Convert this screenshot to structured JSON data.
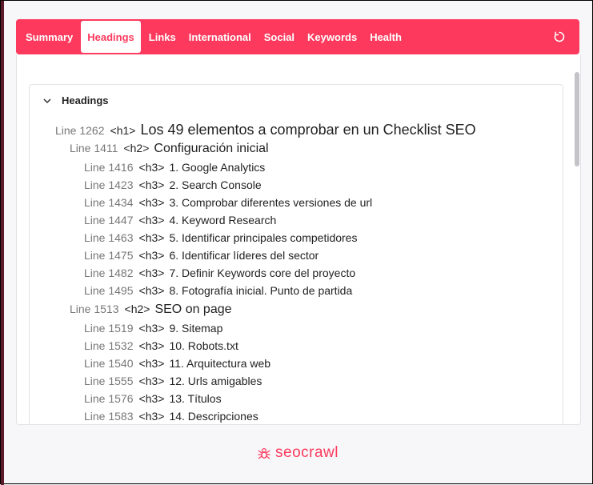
{
  "nav": {
    "tabs": [
      {
        "label": "Summary",
        "active": false
      },
      {
        "label": "Headings",
        "active": true
      },
      {
        "label": "Links",
        "active": false
      },
      {
        "label": "International",
        "active": false
      },
      {
        "label": "Social",
        "active": false
      },
      {
        "label": "Keywords",
        "active": false
      },
      {
        "label": "Health",
        "active": false
      }
    ],
    "refresh_icon": "refresh-icon"
  },
  "colors": {
    "brand": "#fd3a5d",
    "text": "#222222",
    "muted": "#777777"
  },
  "headings": {
    "title": "Headings",
    "toggle_icon": "chevron-down-icon",
    "items": [
      {
        "line": "Line 1262",
        "tag": "<h1>",
        "text": "Los 49 elementos a comprobar en un Checklist SEO",
        "level": 1
      },
      {
        "line": "Line 1411",
        "tag": "<h2>",
        "text": "Configuración inicial",
        "level": 2
      },
      {
        "line": "Line 1416",
        "tag": "<h3>",
        "text": "1. Google Analytics",
        "level": 3
      },
      {
        "line": "Line 1423",
        "tag": "<h3>",
        "text": "2. Search Console",
        "level": 3
      },
      {
        "line": "Line 1434",
        "tag": "<h3>",
        "text": "3. Comprobar diferentes versiones de url",
        "level": 3
      },
      {
        "line": "Line 1447",
        "tag": "<h3>",
        "text": "4. Keyword Research",
        "level": 3
      },
      {
        "line": "Line 1463",
        "tag": "<h3>",
        "text": "5. Identificar principales competidores",
        "level": 3
      },
      {
        "line": "Line 1475",
        "tag": "<h3>",
        "text": "6. Identificar líderes del sector",
        "level": 3
      },
      {
        "line": "Line 1482",
        "tag": "<h3>",
        "text": "7. Definir Keywords core del proyecto",
        "level": 3
      },
      {
        "line": "Line 1495",
        "tag": "<h3>",
        "text": "8. Fotografía inicial. Punto de partida",
        "level": 3
      },
      {
        "line": "Line 1513",
        "tag": "<h2>",
        "text": "SEO on page",
        "level": 2
      },
      {
        "line": "Line 1519",
        "tag": "<h3>",
        "text": "9. Sitemap",
        "level": 3
      },
      {
        "line": "Line 1532",
        "tag": "<h3>",
        "text": "10. Robots.txt",
        "level": 3
      },
      {
        "line": "Line 1540",
        "tag": "<h3>",
        "text": "11. Arquitectura web",
        "level": 3
      },
      {
        "line": "Line 1555",
        "tag": "<h3>",
        "text": "12. Urls amigables",
        "level": 3
      },
      {
        "line": "Line 1576",
        "tag": "<h3>",
        "text": "13. Títulos",
        "level": 3
      },
      {
        "line": "Line 1583",
        "tag": "<h3>",
        "text": "14. Descripciones",
        "level": 3
      }
    ]
  },
  "footer": {
    "brand": "seocrawl",
    "logo_icon": "spider-logo-icon"
  }
}
